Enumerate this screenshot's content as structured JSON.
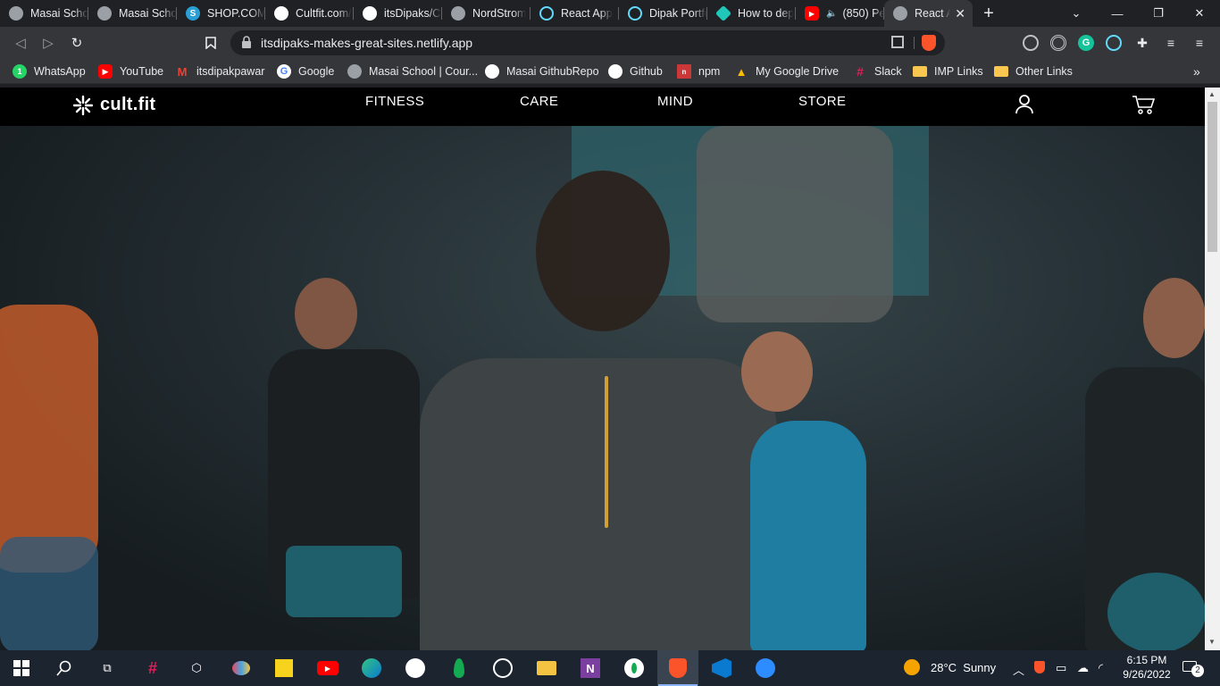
{
  "browser": {
    "tabs": [
      {
        "title": "Masai Schoo",
        "icon": "globe-icon",
        "color": "#9aa0a6"
      },
      {
        "title": "Masai Schoo",
        "icon": "globe-icon",
        "color": "#9aa0a6"
      },
      {
        "title": "SHOP.COM",
        "icon": "shop-s-icon",
        "color": "#2a9fd6"
      },
      {
        "title": "Cultfit.com/",
        "icon": "github-icon",
        "color": "#ffffff"
      },
      {
        "title": "itsDipaks/Cu",
        "icon": "github-icon",
        "color": "#ffffff"
      },
      {
        "title": "NordStrom",
        "icon": "globe-icon",
        "color": "#9aa0a6"
      },
      {
        "title": "React App",
        "icon": "react-icon",
        "color": "#61dafb"
      },
      {
        "title": "Dipak Portfo",
        "icon": "react-icon",
        "color": "#61dafb"
      },
      {
        "title": "How to dep",
        "icon": "netlify-icon",
        "color": "#20c6b7"
      },
      {
        "title": "(850) Pe",
        "icon": "youtube-icon",
        "color": "#ff0000"
      },
      {
        "title": "React A",
        "icon": "globe-icon",
        "color": "#9aa0a6",
        "active": true
      }
    ],
    "url": "itsdipaks-makes-great-sites.netlify.app",
    "bookmarks": [
      {
        "label": "WhatsApp",
        "icon": "whatsapp-icon",
        "color": "#25d366"
      },
      {
        "label": "YouTube",
        "icon": "youtube-icon",
        "color": "#ff0000"
      },
      {
        "label": "itsdipakpawar",
        "icon": "gmail-icon",
        "color": "#ea4335"
      },
      {
        "label": "Google",
        "icon": "google-icon",
        "color": "#ffffff"
      },
      {
        "label": "Masai School | Cour...",
        "icon": "globe-icon",
        "color": "#9aa0a6"
      },
      {
        "label": "Masai GithubRepo",
        "icon": "github-icon",
        "color": "#ffffff"
      },
      {
        "label": "Github",
        "icon": "github-icon",
        "color": "#ffffff"
      },
      {
        "label": "npm",
        "icon": "npm-icon",
        "color": "#cb3837"
      },
      {
        "label": "My Google Drive",
        "icon": "drive-icon",
        "color": "#fbbc04"
      },
      {
        "label": "Slack",
        "icon": "slack-icon",
        "color": "#e01e5a"
      },
      {
        "label": "IMP Links",
        "icon": "folder-icon",
        "color": "#f9c74f"
      },
      {
        "label": "Other Links",
        "icon": "folder-icon",
        "color": "#f9c74f"
      }
    ]
  },
  "site": {
    "logo": "cult.fit",
    "nav": [
      {
        "label": "FITNESS"
      },
      {
        "label": "CARE"
      },
      {
        "label": "MIND"
      },
      {
        "label": "STORE"
      }
    ]
  },
  "taskbar": {
    "apps": [
      "windows-start-icon",
      "search-icon",
      "task-view-icon",
      "slack-icon",
      "3d-viewer-icon",
      "paint-icon",
      "sticky-notes-icon",
      "youtube-icon",
      "edge-icon",
      "github-desktop-icon",
      "mongodb-icon",
      "whatsapp-icon",
      "file-explorer-icon",
      "onenote-icon",
      "mongodb-compass-icon",
      "brave-icon",
      "vscode-icon",
      "zoom-icon"
    ],
    "weather": "28°C  Sunny",
    "time": "6:15 PM",
    "date": "9/26/2022",
    "notifications": "2"
  }
}
